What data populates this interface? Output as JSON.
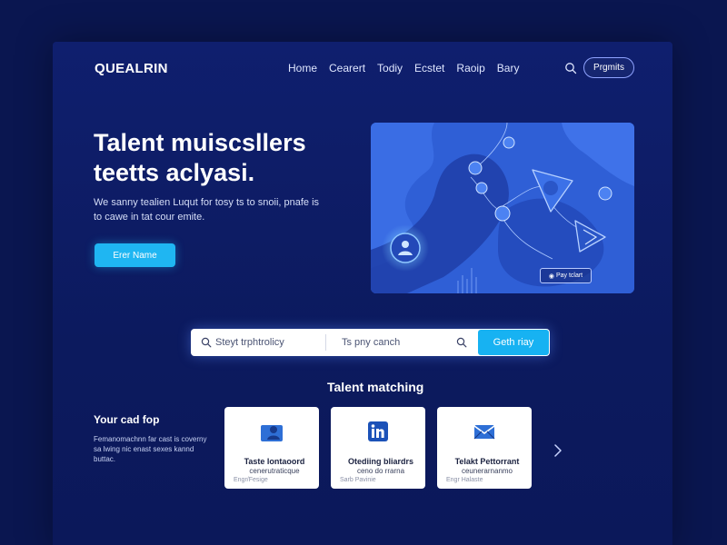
{
  "header": {
    "logo": "QUEALRIN",
    "nav": [
      "Home",
      "Cearert",
      "Todiy",
      "Ecstet",
      "Raoip",
      "Bary"
    ],
    "cta_label": "Prgmits"
  },
  "hero": {
    "title": "Talent muiscsllers teetts aclyasi.",
    "subtitle": "We sanny tealien Luqut for tosy ts to snoii, pnafe is to cawe in tat cour emite.",
    "cta_label": "Erer Name",
    "image_badge": "Pay tclart"
  },
  "search": {
    "field1_placeholder": "Steyt trphtrolicy",
    "field2_placeholder": "Ts pny canch",
    "button_label": "Geth riay"
  },
  "matching": {
    "title": "Talent matching",
    "left_heading": "Your cad fop",
    "left_text": "Femanomachnn far cast is coverny sa lwing nic enast sexes kannd buttac.",
    "cards": [
      {
        "icon": "user-icon",
        "title": "Taste lontaoord",
        "subtitle": "cenerutraticque",
        "meta": "Engr/Fesige"
      },
      {
        "icon": "linkedin-icon",
        "title": "Otediing bliardrs",
        "subtitle": "ceno do rrarna",
        "meta": "Sarb Pavinie"
      },
      {
        "icon": "mail-icon",
        "title": "Telakt Pettorrant",
        "subtitle": "ceunerarnanmo",
        "meta": "Engr Halaste"
      }
    ]
  },
  "colors": {
    "background": "#0a1650",
    "accent": "#1fb6f2",
    "hero_image": "#2f5fd6"
  }
}
